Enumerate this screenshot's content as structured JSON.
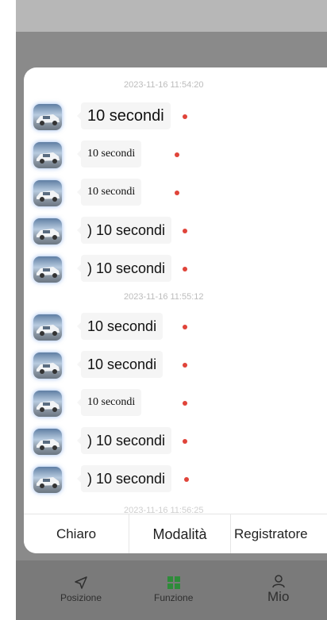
{
  "modal": {
    "groups": [
      {
        "timestamp": "2023-11-16 11:54:20",
        "messages": [
          {
            "text": "10 secondi",
            "size": "lg"
          },
          {
            "text": "10 secondi",
            "size": "sm"
          },
          {
            "text": "10 secondi",
            "size": "sm"
          },
          {
            "text": ") 10 secondi",
            "size": "md"
          },
          {
            "text": ") 10 secondi",
            "size": "md"
          }
        ]
      },
      {
        "timestamp": "2023-11-16 11:55:12",
        "messages": [
          {
            "text": "10 secondi",
            "size": "lg"
          },
          {
            "text": "10 secondi",
            "size": "lg"
          },
          {
            "text": "10 secondi",
            "size": "sm"
          },
          {
            "text": ") 10 secondi",
            "size": "md"
          },
          {
            "text": ") 10 secondi",
            "size": "lg"
          }
        ]
      }
    ],
    "partial_timestamp": "2023-11-16 11:56:25",
    "tabs": {
      "clear_label": "Chiaro",
      "mode_label": "Modalità",
      "recorder_label": "Registratore"
    }
  },
  "bottom_nav": {
    "position_label": "Posizione",
    "function_label": "Funzione",
    "mine_label": "Mio",
    "colors": {
      "active": "#2e8b3a",
      "inactive": "#2f2f2f"
    }
  },
  "colors": {
    "unread_dot": "#e0443a",
    "bubble": "#f5f5f5",
    "overlay": "#8a8a8a"
  }
}
